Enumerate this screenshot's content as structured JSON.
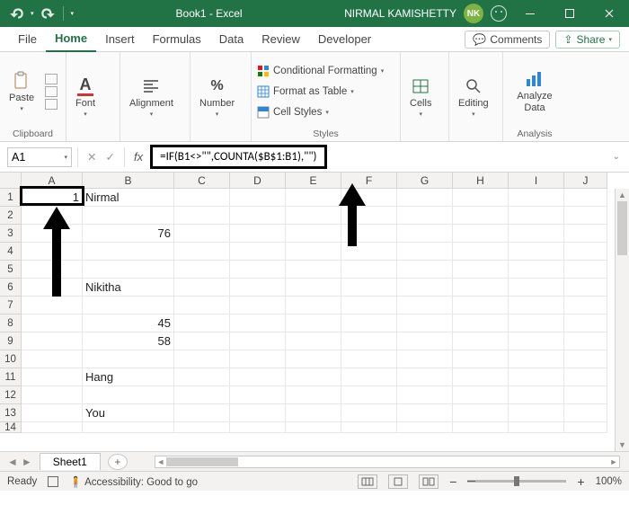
{
  "title": "Book1 - Excel",
  "username": "NIRMAL KAMISHETTY",
  "avatar_initials": "NK",
  "tabs": {
    "file": "File",
    "home": "Home",
    "insert": "Insert",
    "formulas": "Formulas",
    "data": "Data",
    "review": "Review",
    "developer": "Developer"
  },
  "actions": {
    "comments": "Comments",
    "share": "Share"
  },
  "ribbon": {
    "paste": "Paste",
    "clipboard": "Clipboard",
    "font": "Font",
    "alignment": "Alignment",
    "number": "Number",
    "cond_fmt": "Conditional Formatting",
    "fmt_table": "Format as Table",
    "cell_styles": "Cell Styles",
    "styles": "Styles",
    "cells": "Cells",
    "editing": "Editing",
    "analyze": "Analyze Data",
    "analysis": "Analysis"
  },
  "namebox": "A1",
  "formula": "=IF(B1<>\"\",COUNTA($B$1:B1),\"\")",
  "columns": [
    "A",
    "B",
    "C",
    "D",
    "E",
    "F",
    "G",
    "H",
    "I",
    "J"
  ],
  "rows": [
    "1",
    "2",
    "3",
    "4",
    "5",
    "6",
    "7",
    "8",
    "9",
    "10",
    "11",
    "12",
    "13",
    "14"
  ],
  "cells": {
    "A1": "1",
    "B1": "Nirmal",
    "B3": "76",
    "B6": "Nikitha",
    "B8": "45",
    "B9": "58",
    "B11": "Hang",
    "B13": "You"
  },
  "sheet": {
    "name": "Sheet1"
  },
  "status": {
    "ready": "Ready",
    "accessibility": "Accessibility: Good to go",
    "zoom": "100%"
  }
}
